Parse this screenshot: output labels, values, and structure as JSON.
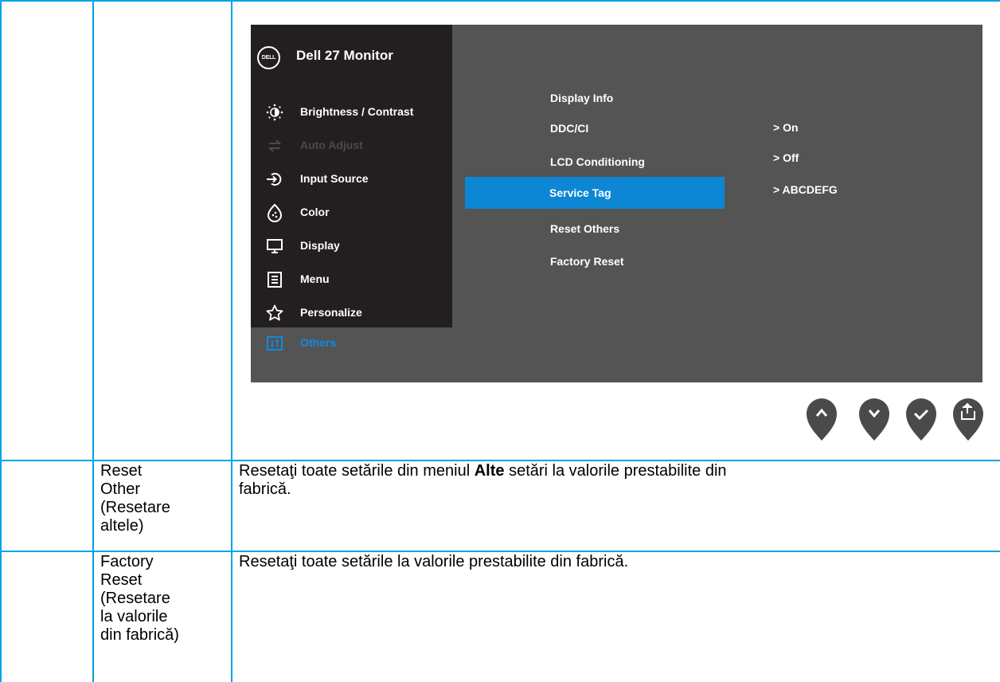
{
  "osd": {
    "brand_logo": "DELL",
    "title": "Dell 27 Monitor",
    "menu": [
      {
        "label": "Brightness / Contrast",
        "icon": "brightness-icon",
        "state": "normal"
      },
      {
        "label": "Auto Adjust",
        "icon": "auto-adjust-icon",
        "state": "disabled"
      },
      {
        "label": "Input Source",
        "icon": "input-source-icon",
        "state": "normal"
      },
      {
        "label": "Color",
        "icon": "color-icon",
        "state": "normal"
      },
      {
        "label": "Display",
        "icon": "display-icon",
        "state": "normal"
      },
      {
        "label": "Menu",
        "icon": "menu-icon",
        "state": "normal"
      },
      {
        "label": "Personalize",
        "icon": "star-icon",
        "state": "normal"
      },
      {
        "label": "Others",
        "icon": "others-icon",
        "state": "selected"
      }
    ],
    "submenu": [
      {
        "label": "Display Info"
      },
      {
        "label": "DDC/CI"
      },
      {
        "label": "LCD Conditioning"
      },
      {
        "label": "Service Tag",
        "selected": true
      },
      {
        "label": "Reset Others"
      },
      {
        "label": "Factory Reset"
      }
    ],
    "values": {
      "ddc_ci": ">  On",
      "lcd_conditioning": ">  Off",
      "service_tag": ">  ABCDEFG"
    },
    "buttons": [
      "up-arrow-icon",
      "down-arrow-icon",
      "check-icon",
      "back-icon"
    ],
    "colors": {
      "accent": "#0d86d4",
      "panel": "#545454",
      "sidebar": "#231f20",
      "button": "#4a4a4a"
    }
  },
  "table": {
    "rows": [
      {
        "name_lines": [
          "Reset",
          "Other",
          "(Resetare",
          "altele)"
        ],
        "desc_before": "Resetaţi toate setările din meniul ",
        "desc_bold": "Alte",
        "desc_after": " setări la valorile prestabilite din",
        "desc_line2": "fabrică."
      },
      {
        "name_lines": [
          "Factory",
          "Reset",
          "(Resetare",
          "la valorile",
          "din fabrică)"
        ],
        "desc": "Resetaţi toate setările la valorile prestabilite din fabrică."
      }
    ]
  }
}
